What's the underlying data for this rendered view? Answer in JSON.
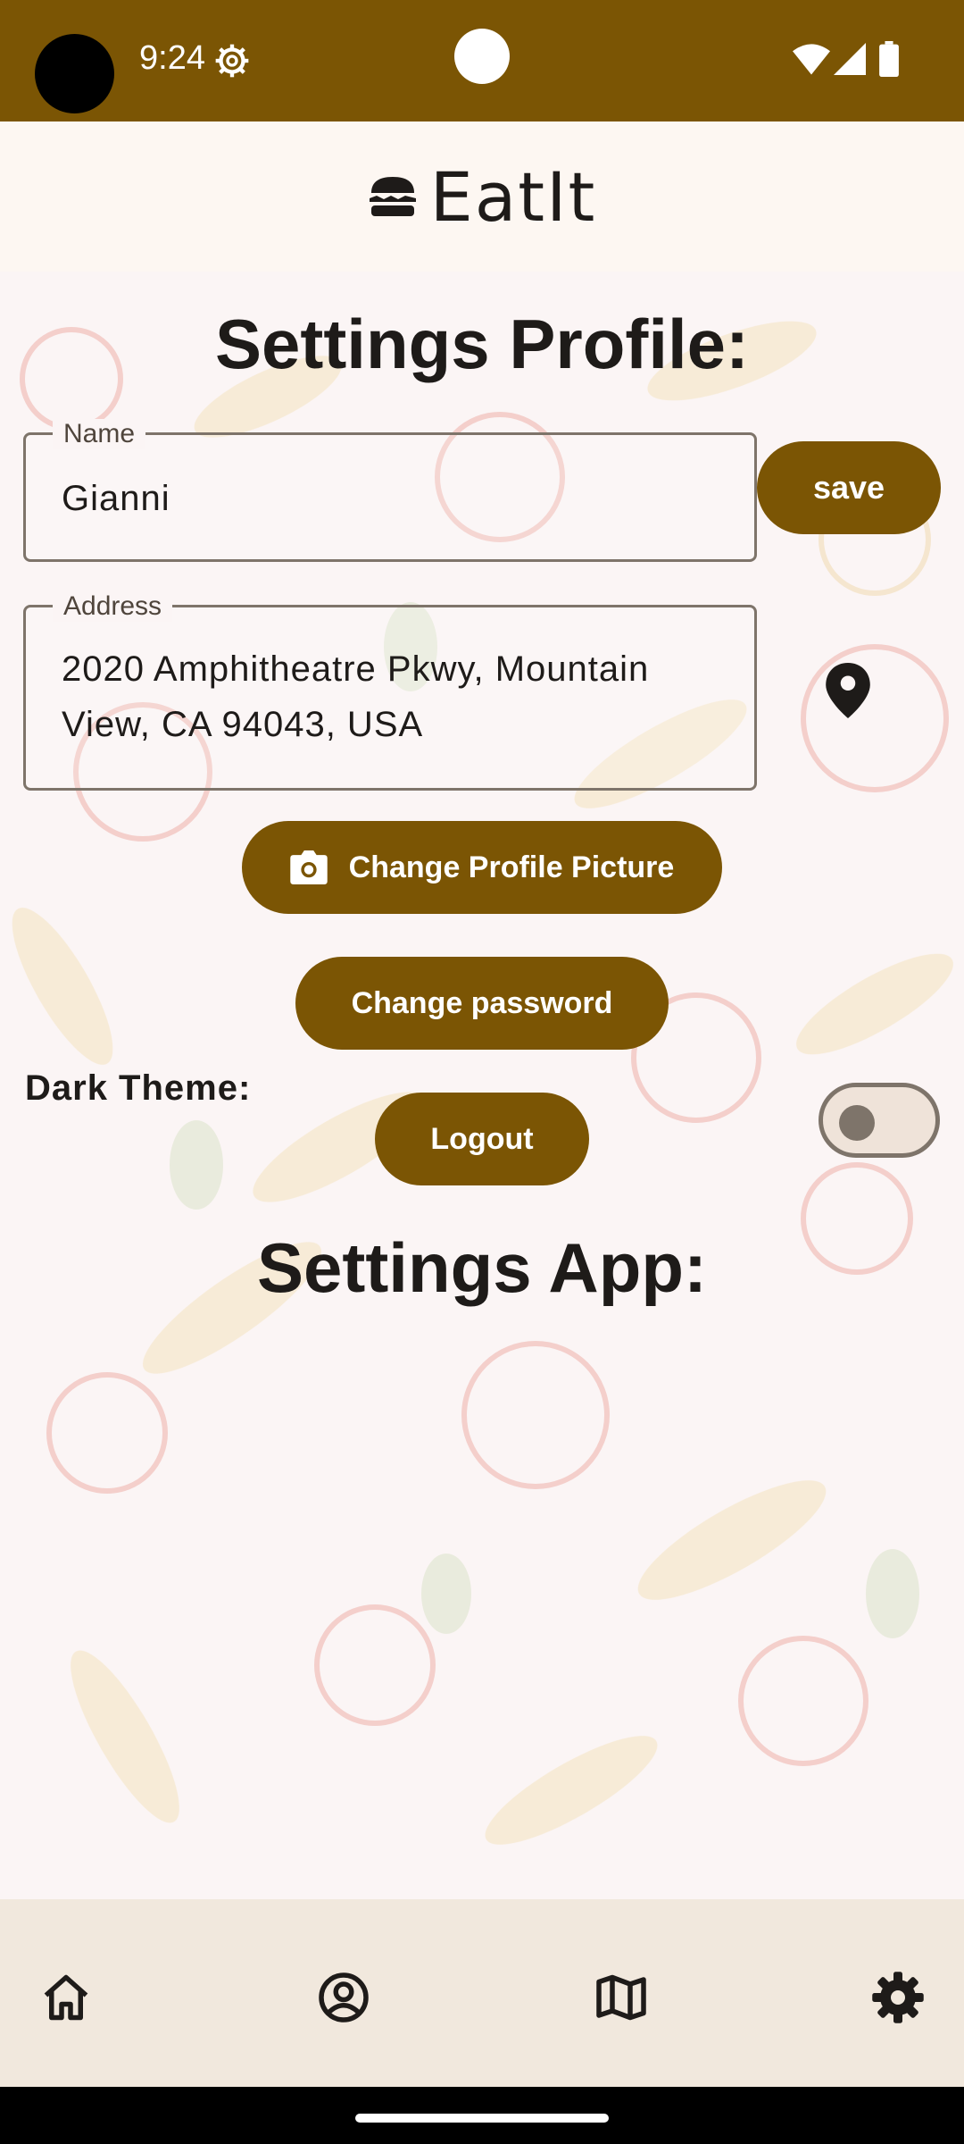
{
  "status_bar": {
    "time": "9:24",
    "icons": [
      "camera-cutout",
      "settings-gear-icon",
      "wifi-icon",
      "signal-icon",
      "battery-icon"
    ]
  },
  "app": {
    "name": "EatIt",
    "logo_icon": "burger-icon",
    "accent_color": "#7b5504"
  },
  "profile": {
    "section_title": "Settings Profile:",
    "name_label": "Name",
    "name_value": "Gianni",
    "save_label": "save",
    "address_label": "Address",
    "address_line1": "2020 Amphitheatre Pkwy, Mountain",
    "address_line2": "View, CA 94043, USA",
    "location_icon": "location-pin-icon",
    "change_picture_label": "Change Profile Picture",
    "change_picture_icon": "camera-icon",
    "change_password_label": "Change password",
    "logout_label": "Logout"
  },
  "app_settings": {
    "section_title": "Settings App:",
    "dark_theme_label": "Dark Theme:",
    "dark_theme_on": false
  },
  "bottom_nav": {
    "items": [
      {
        "icon": "home-icon"
      },
      {
        "icon": "profile-icon"
      },
      {
        "icon": "map-icon"
      },
      {
        "icon": "settings-icon",
        "selected": true
      }
    ]
  }
}
